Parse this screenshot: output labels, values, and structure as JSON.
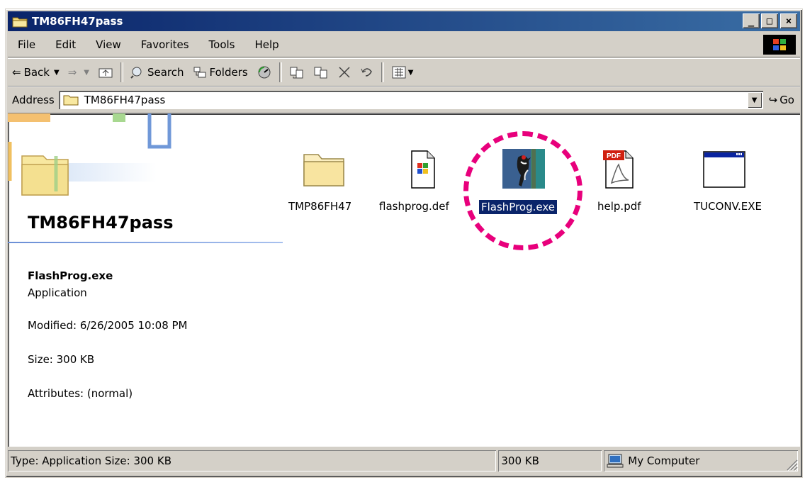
{
  "window": {
    "title": "TM86FH47pass"
  },
  "caption_buttons": {
    "minimize": "_",
    "maximize": "□",
    "close": "×"
  },
  "menu": [
    "File",
    "Edit",
    "View",
    "Favorites",
    "Tools",
    "Help"
  ],
  "toolbar": {
    "back": "Back",
    "search": "Search",
    "folders": "Folders"
  },
  "address": {
    "label": "Address",
    "value": "TM86FH47pass",
    "go": "Go"
  },
  "left_pane": {
    "folder_title": "TM86FH47pass",
    "selected_name": "FlashProg.exe",
    "selected_type": "Application",
    "modified": "Modified: 6/26/2005 10:08 PM",
    "size": "Size: 300 KB",
    "attributes": "Attributes: (normal)"
  },
  "files": [
    {
      "name": "TMP86FH47",
      "kind": "folder"
    },
    {
      "name": "flashprog.def",
      "kind": "doc"
    },
    {
      "name": "FlashProg.exe",
      "kind": "app",
      "selected": true
    },
    {
      "name": "help.pdf",
      "kind": "pdf"
    },
    {
      "name": "TUCONV.EXE",
      "kind": "exe"
    }
  ],
  "pdf_badge": "PDF",
  "status": {
    "info": "Type: Application Size: 300 KB",
    "size": "300 KB",
    "zone": "My Computer"
  },
  "colors": {
    "titlebar": "#0a246a",
    "highlight": "#0a246a",
    "annotation": "#e8007c",
    "chrome": "#d4d0c8"
  }
}
